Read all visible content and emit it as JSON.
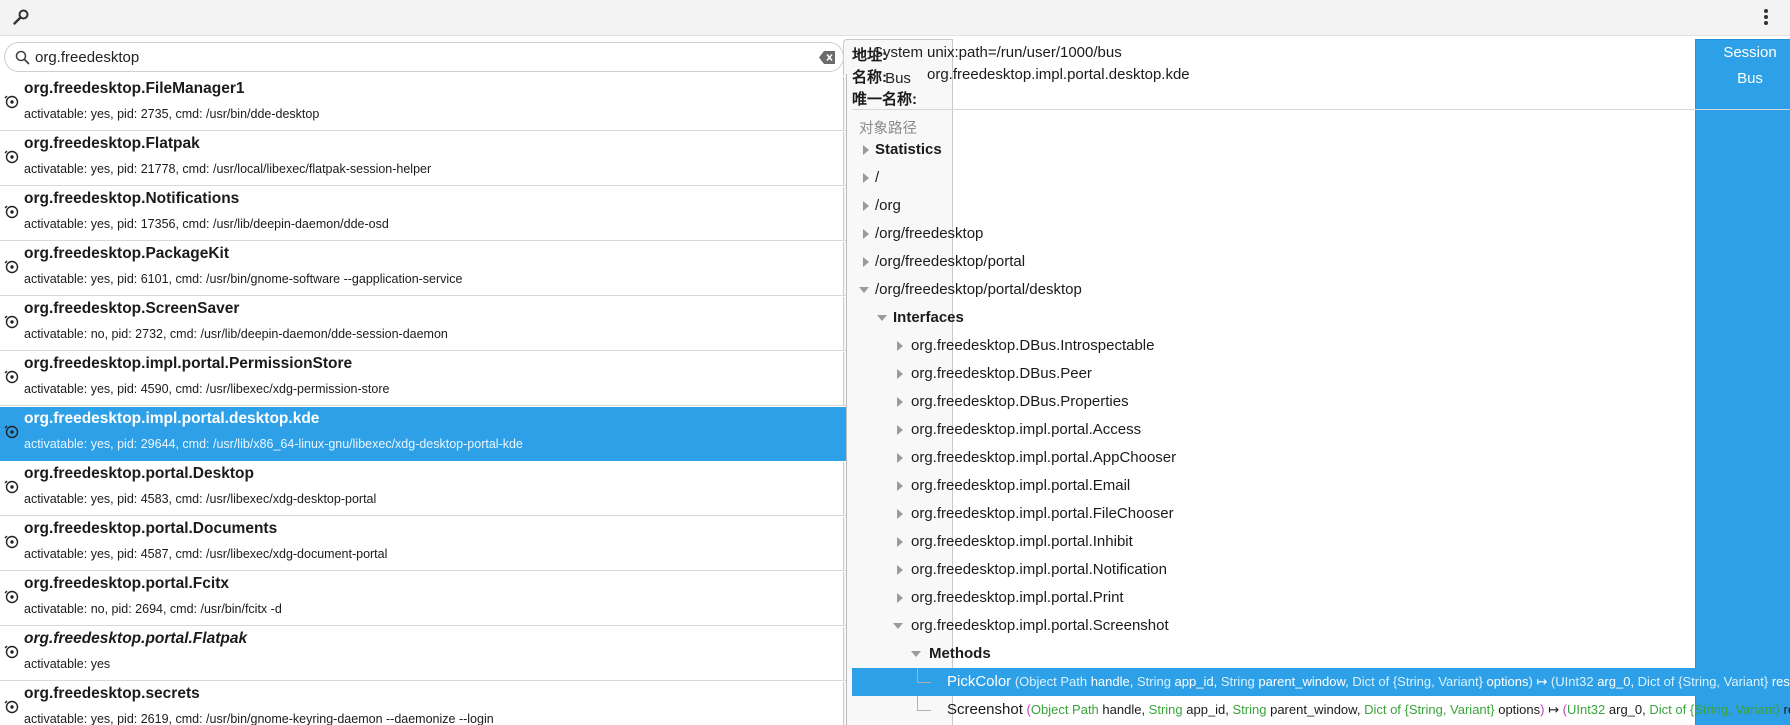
{
  "toolbar": {
    "wrench_icon": "wrench-icon",
    "system_bus_label": "System Bus",
    "session_bus_label": "Session Bus",
    "menu_icon": "kebab-menu-icon",
    "active_color": "#2ea0e8"
  },
  "search": {
    "value": "org.freedesktop",
    "icon": "search-icon",
    "clear_icon": "clear-icon"
  },
  "services": [
    {
      "name": "org.freedesktop.FileManager1",
      "desc": "activatable: yes, pid: 2735, cmd: /usr/bin/dde-desktop"
    },
    {
      "name": "org.freedesktop.Flatpak",
      "desc": "activatable: yes, pid: 21778, cmd: /usr/local/libexec/flatpak-session-helper"
    },
    {
      "name": "org.freedesktop.Notifications",
      "desc": "activatable: yes, pid: 17356, cmd: /usr/lib/deepin-daemon/dde-osd"
    },
    {
      "name": "org.freedesktop.PackageKit",
      "desc": "activatable: yes, pid: 6101, cmd: /usr/bin/gnome-software --gapplication-service"
    },
    {
      "name": "org.freedesktop.ScreenSaver",
      "desc": "activatable: no, pid: 2732, cmd: /usr/lib/deepin-daemon/dde-session-daemon"
    },
    {
      "name": "org.freedesktop.impl.portal.PermissionStore",
      "desc": "activatable: yes, pid: 4590, cmd: /usr/libexec/xdg-permission-store"
    },
    {
      "name": "org.freedesktop.impl.portal.desktop.kde",
      "desc": "activatable: yes, pid: 29644, cmd: /usr/lib/x86_64-linux-gnu/libexec/xdg-desktop-portal-kde"
    },
    {
      "name": "org.freedesktop.portal.Desktop",
      "desc": "activatable: yes, pid: 4583, cmd: /usr/libexec/xdg-desktop-portal"
    },
    {
      "name": "org.freedesktop.portal.Documents",
      "desc": "activatable: yes, pid: 4587, cmd: /usr/libexec/xdg-document-portal"
    },
    {
      "name": "org.freedesktop.portal.Fcitx",
      "desc": "activatable: no, pid: 2694, cmd: /usr/bin/fcitx -d"
    },
    {
      "name": "org.freedesktop.portal.Flatpak",
      "desc": "activatable: yes"
    },
    {
      "name": "org.freedesktop.secrets",
      "desc": "activatable: yes, pid: 2619, cmd: /usr/bin/gnome-keyring-daemon --daemonize --login"
    }
  ],
  "info": {
    "address_label": "地址:",
    "address_value": "unix:path=/run/user/1000/bus",
    "name_label": "名称:",
    "name_value": "org.freedesktop.impl.portal.desktop.kde",
    "unique_label": "唯一名称:",
    "unique_value": ""
  },
  "tree": {
    "header": "对象路径",
    "statistics": "Statistics",
    "paths": [
      "/",
      "/org",
      "/org/freedesktop",
      "/org/freedesktop/portal",
      "/org/freedesktop/portal/desktop"
    ],
    "interfaces_label": "Interfaces",
    "interfaces": [
      "org.freedesktop.DBus.Introspectable",
      "org.freedesktop.DBus.Peer",
      "org.freedesktop.DBus.Properties",
      "org.freedesktop.impl.portal.Access",
      "org.freedesktop.impl.portal.AppChooser",
      "org.freedesktop.impl.portal.Email",
      "org.freedesktop.impl.portal.FileChooser",
      "org.freedesktop.impl.portal.Inhibit",
      "org.freedesktop.impl.portal.Notification",
      "org.freedesktop.impl.portal.Print",
      "org.freedesktop.impl.portal.Screenshot"
    ],
    "methods_label": "Methods",
    "methods": [
      {
        "name": "PickColor",
        "open": "(",
        "t1": "Object Path",
        "a1": " handle, ",
        "t2": "String",
        "a2": " app_id, ",
        "t3": "String",
        "a3": " parent_window, ",
        "t4": "Dict of {String, Variant}",
        "a4": " options",
        "close": ")",
        "arrow": " ↦ ",
        "ropen": "(",
        "r1t": "UInt32",
        "r1a": " arg_0, ",
        "r2t": "Dict of {String, Variant}",
        "r2a": " results",
        "rclose": ")"
      },
      {
        "name": "Screenshot",
        "open": "(",
        "t1": "Object Path",
        "a1": " handle, ",
        "t2": "String",
        "a2": " app_id, ",
        "t3": "String",
        "a3": " parent_window, ",
        "t4": "Dict of {String, Variant}",
        "a4": " options",
        "close": ")",
        "arrow": " ↦ ",
        "ropen": "(",
        "r1t": "UInt32",
        "r1a": " arg_0, ",
        "r2t": "Dict of {String, Variant}",
        "r2a": " results",
        "rclose": ")"
      }
    ]
  }
}
